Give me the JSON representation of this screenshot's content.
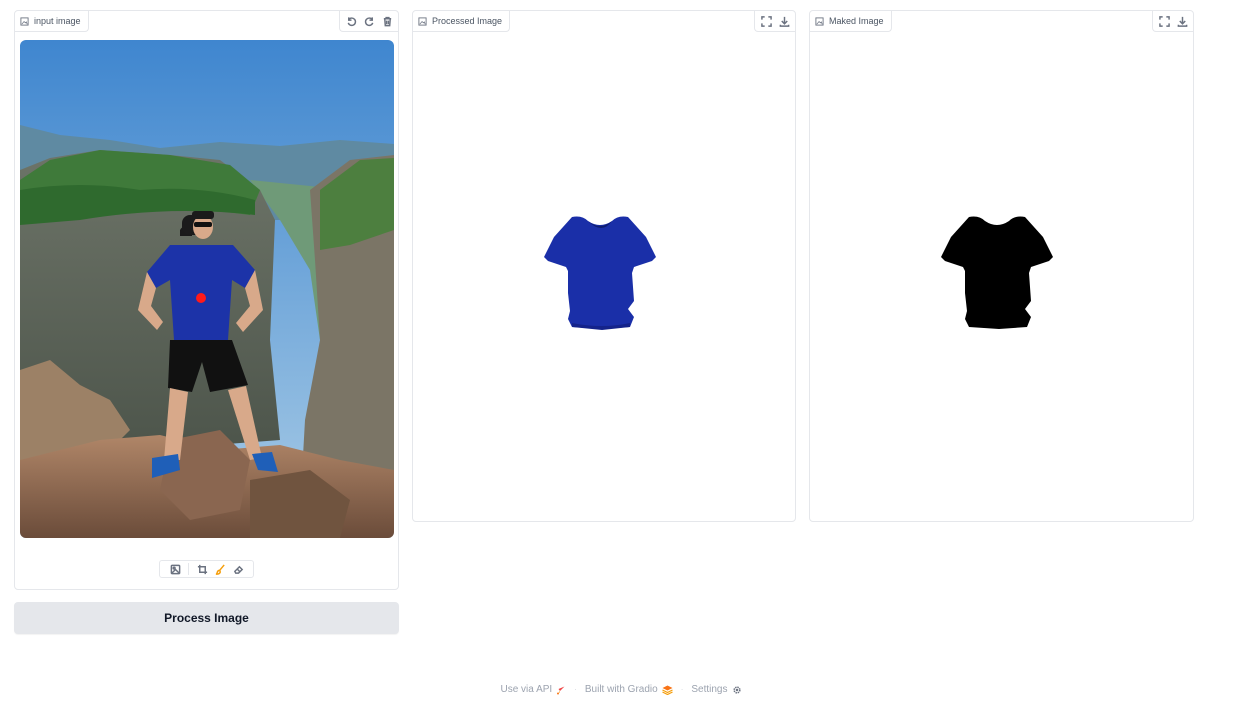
{
  "input_panel": {
    "label": "input image",
    "label_icon": "image-icon",
    "toolbar": [
      "undo-icon",
      "redo-icon",
      "trash-icon"
    ]
  },
  "processed_panel": {
    "label": "Processed Image",
    "label_icon": "image-icon",
    "toolbar": [
      "fullscreen-icon",
      "download-icon"
    ]
  },
  "masked_panel": {
    "label": "Maked Image",
    "label_icon": "image-icon",
    "toolbar": [
      "fullscreen-icon",
      "download-icon"
    ]
  },
  "edit_tools": [
    "image-icon",
    "crop-icon",
    "brush-icon",
    "eraser-icon"
  ],
  "process_button": {
    "label": "Process Image"
  },
  "footer": {
    "api_label": "Use via API",
    "gradio_label": "Built with Gradio",
    "settings_label": "Settings"
  },
  "colors": {
    "shirt_blue": "#1a2fa8",
    "mask_black": "#000000",
    "point_red": "#ff1a1a"
  }
}
